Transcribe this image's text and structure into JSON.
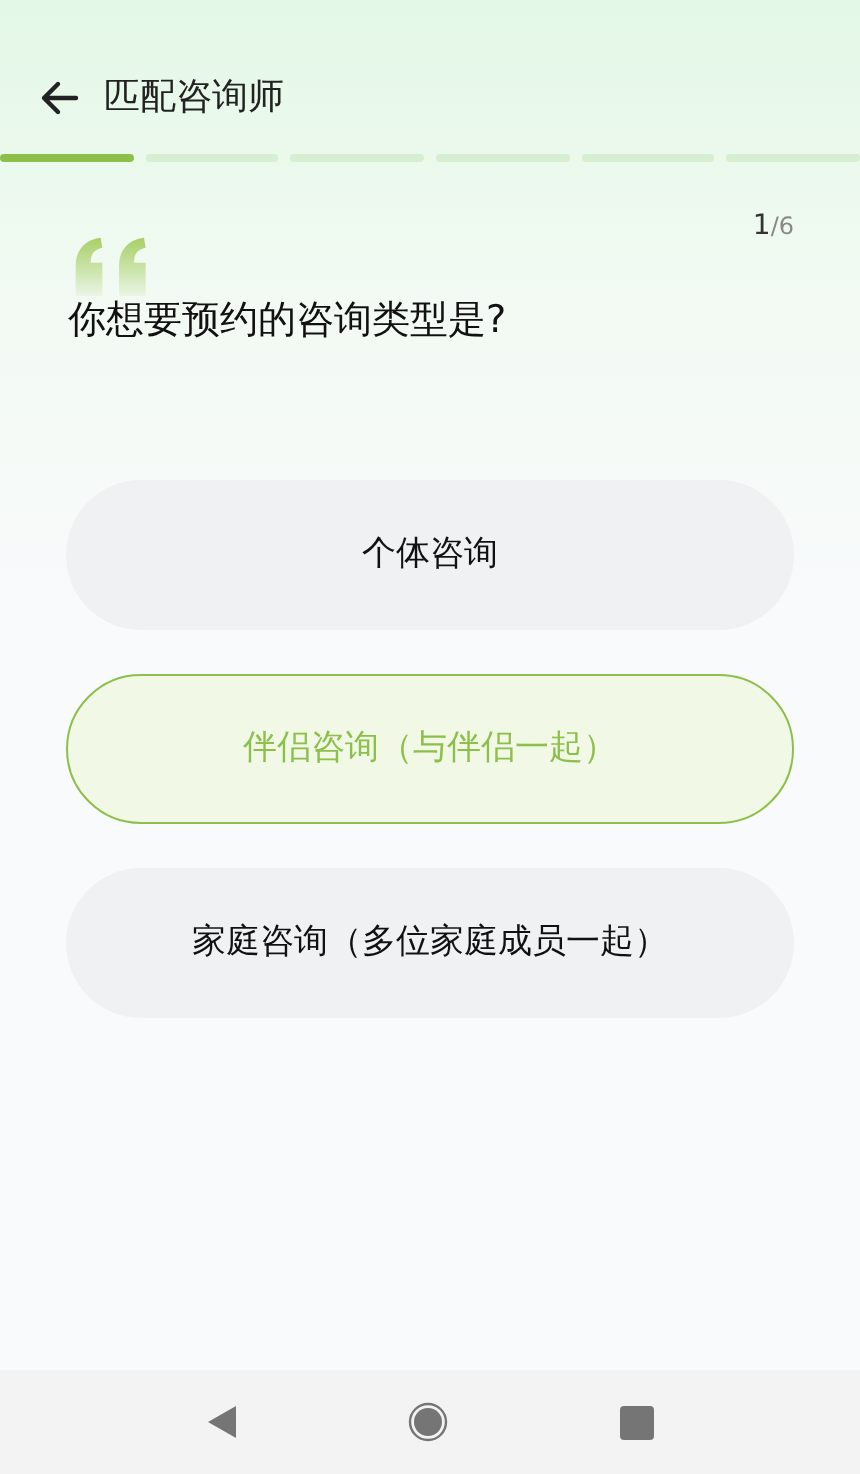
{
  "header": {
    "title": "匹配咨询师"
  },
  "progress": [
    {
      "filled": true
    },
    {
      "filled": false
    },
    {
      "filled": false
    },
    {
      "filled": false
    },
    {
      "filled": false
    },
    {
      "filled": false
    }
  ],
  "counter": {
    "current": "1",
    "total": "/6"
  },
  "question": "你想要预约的咨询类型是?",
  "options": [
    {
      "label": "个体咨询",
      "selected": false
    },
    {
      "label": "伴侣咨询（与伴侣一起）",
      "selected": true
    },
    {
      "label": "家庭咨询（多位家庭成员一起）",
      "selected": false
    }
  ]
}
